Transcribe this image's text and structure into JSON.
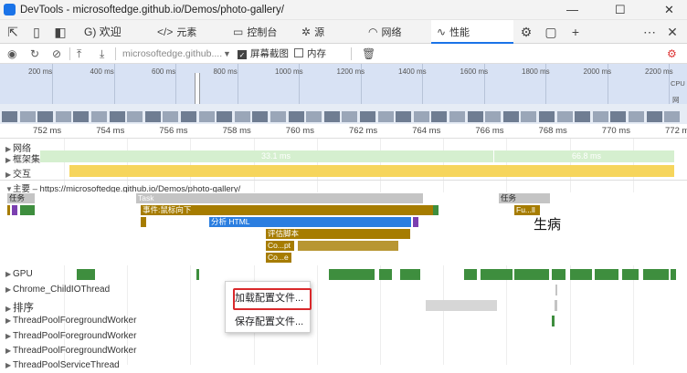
{
  "window": {
    "title": "DevTools - microsoftedge.github.io/Demos/photo-gallery/",
    "controls": {
      "minimize": "—",
      "maximize": "☐",
      "close": "✕"
    }
  },
  "tabs": {
    "welcome": "欢迎",
    "welcome_prefix": "G)",
    "elements": "元素",
    "console": "控制台",
    "sources": "源",
    "network": "网络",
    "performance": "性能",
    "more": "⋯"
  },
  "toolbar": {
    "url_placeholder": "microsoftedge.github....",
    "screenshots_label": "屏幕截图",
    "memory_label": "内存"
  },
  "overview": {
    "labels": [
      "200 ms",
      "400 ms",
      "600 ms",
      "800 ms",
      "1000 ms",
      "1200 ms",
      "1400 ms",
      "1600 ms",
      "1800 ms",
      "2000 ms",
      "2200 ms"
    ],
    "cpu_label": "CPU",
    "net_label": "网"
  },
  "ruler": {
    "labels": [
      "752 ms",
      "754 ms",
      "756 ms",
      "758 ms",
      "760 ms",
      "762 ms",
      "764 ms",
      "766 ms",
      "768 ms",
      "770 ms",
      "772 ms"
    ]
  },
  "tracks": {
    "network": "网络",
    "frames": "框架集",
    "interactions": "交互",
    "main": "主要 – https://microsoftedge.github.io/Demos/photo-gallery/",
    "gpu": "GPU",
    "childio": "Chrome_ChildIOThread",
    "sorting": "排序",
    "pool1": "ThreadPoolForegroundWorker",
    "pool2": "ThreadPoolForegroundWorker",
    "pool3": "ThreadPoolForegroundWorker",
    "pool4": "ThreadPoolServiceThread"
  },
  "frames": {
    "left_value": "33.1 ms",
    "right_value": "66.8 ms"
  },
  "flame": {
    "task1": "任务",
    "task2": "Task",
    "task3": "任务",
    "event": "事件:鼠标向下",
    "parse": "分析 HTML",
    "eval": "评估脚本",
    "copt": "Co...pt",
    "coe": "Co...e",
    "full": "Fu...ll",
    "sick": "生病"
  },
  "menu": {
    "load": "加载配置文件...",
    "save": "保存配置文件..."
  },
  "colors": {
    "accent": "#1a73e8",
    "task_gray": "#c4c4c4",
    "event_gold": "#a67c00",
    "parse_blue": "#2b7ee0",
    "script_brown": "#b8860b",
    "gpu_green": "#3e8e3e",
    "frames_green": "#d5efcf",
    "interaction_yellow": "#f6d55c",
    "highlight_red": "#d9282b"
  }
}
